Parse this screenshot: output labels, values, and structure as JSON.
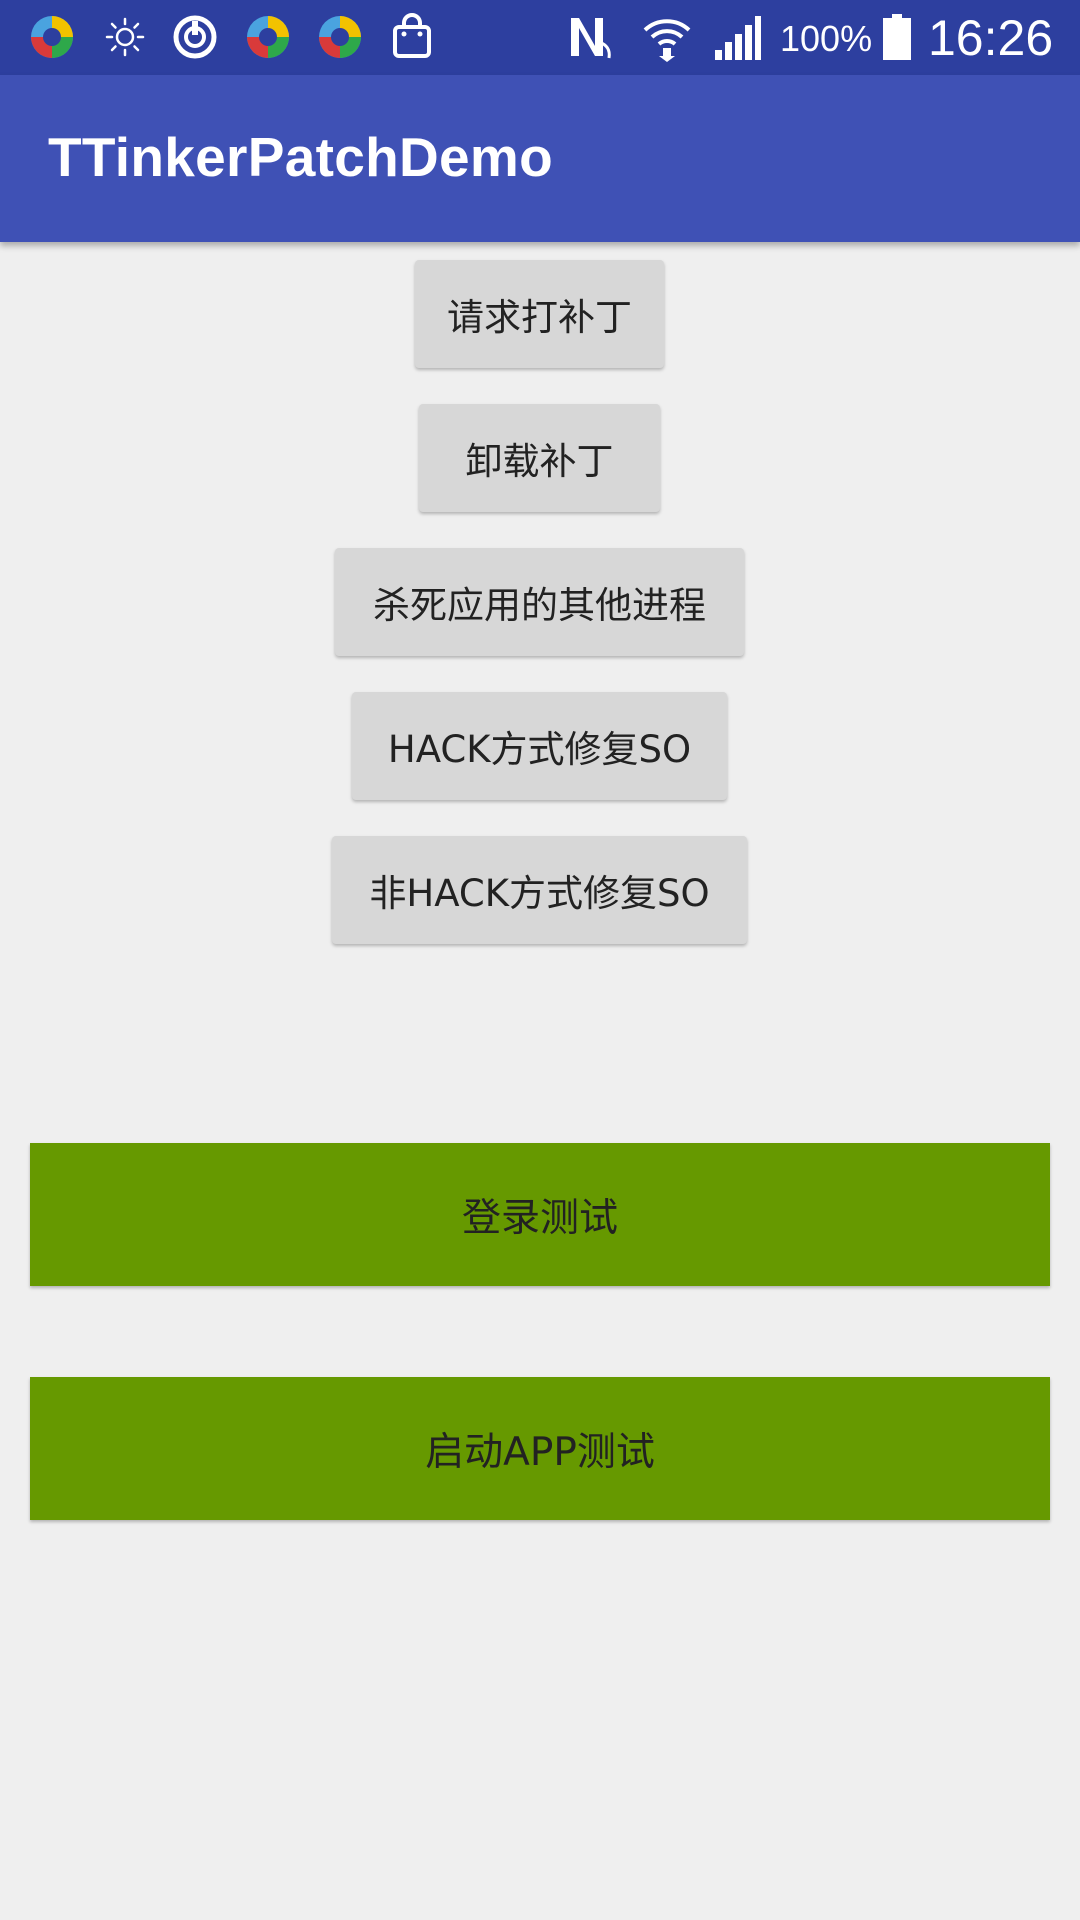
{
  "status_bar": {
    "icons": [
      "app-icon",
      "brightness-icon",
      "sync-icon",
      "app-icon",
      "app-icon",
      "shopping-bag-icon",
      "nfc-icon",
      "wifi-icon",
      "signal-icon",
      "battery-icon"
    ],
    "battery": "100%",
    "time": "16:26"
  },
  "app_bar": {
    "title": "TTinkerPatchDemo"
  },
  "buttons": {
    "request_patch": "请求打补丁",
    "uninstall_patch": "卸载补丁",
    "kill_processes": "杀死应用的其他进程",
    "hack_fix_so": "HACK方式修复SO",
    "non_hack_fix_so": "非HACK方式修复SO",
    "login_test": "登录测试",
    "launch_app_test": "启动APP测试"
  },
  "colors": {
    "status_bar": "#2d3f9f",
    "app_bar": "#3f51b5",
    "background": "#efefef",
    "gray_button": "#d7d7d7",
    "green_button": "#669900"
  }
}
